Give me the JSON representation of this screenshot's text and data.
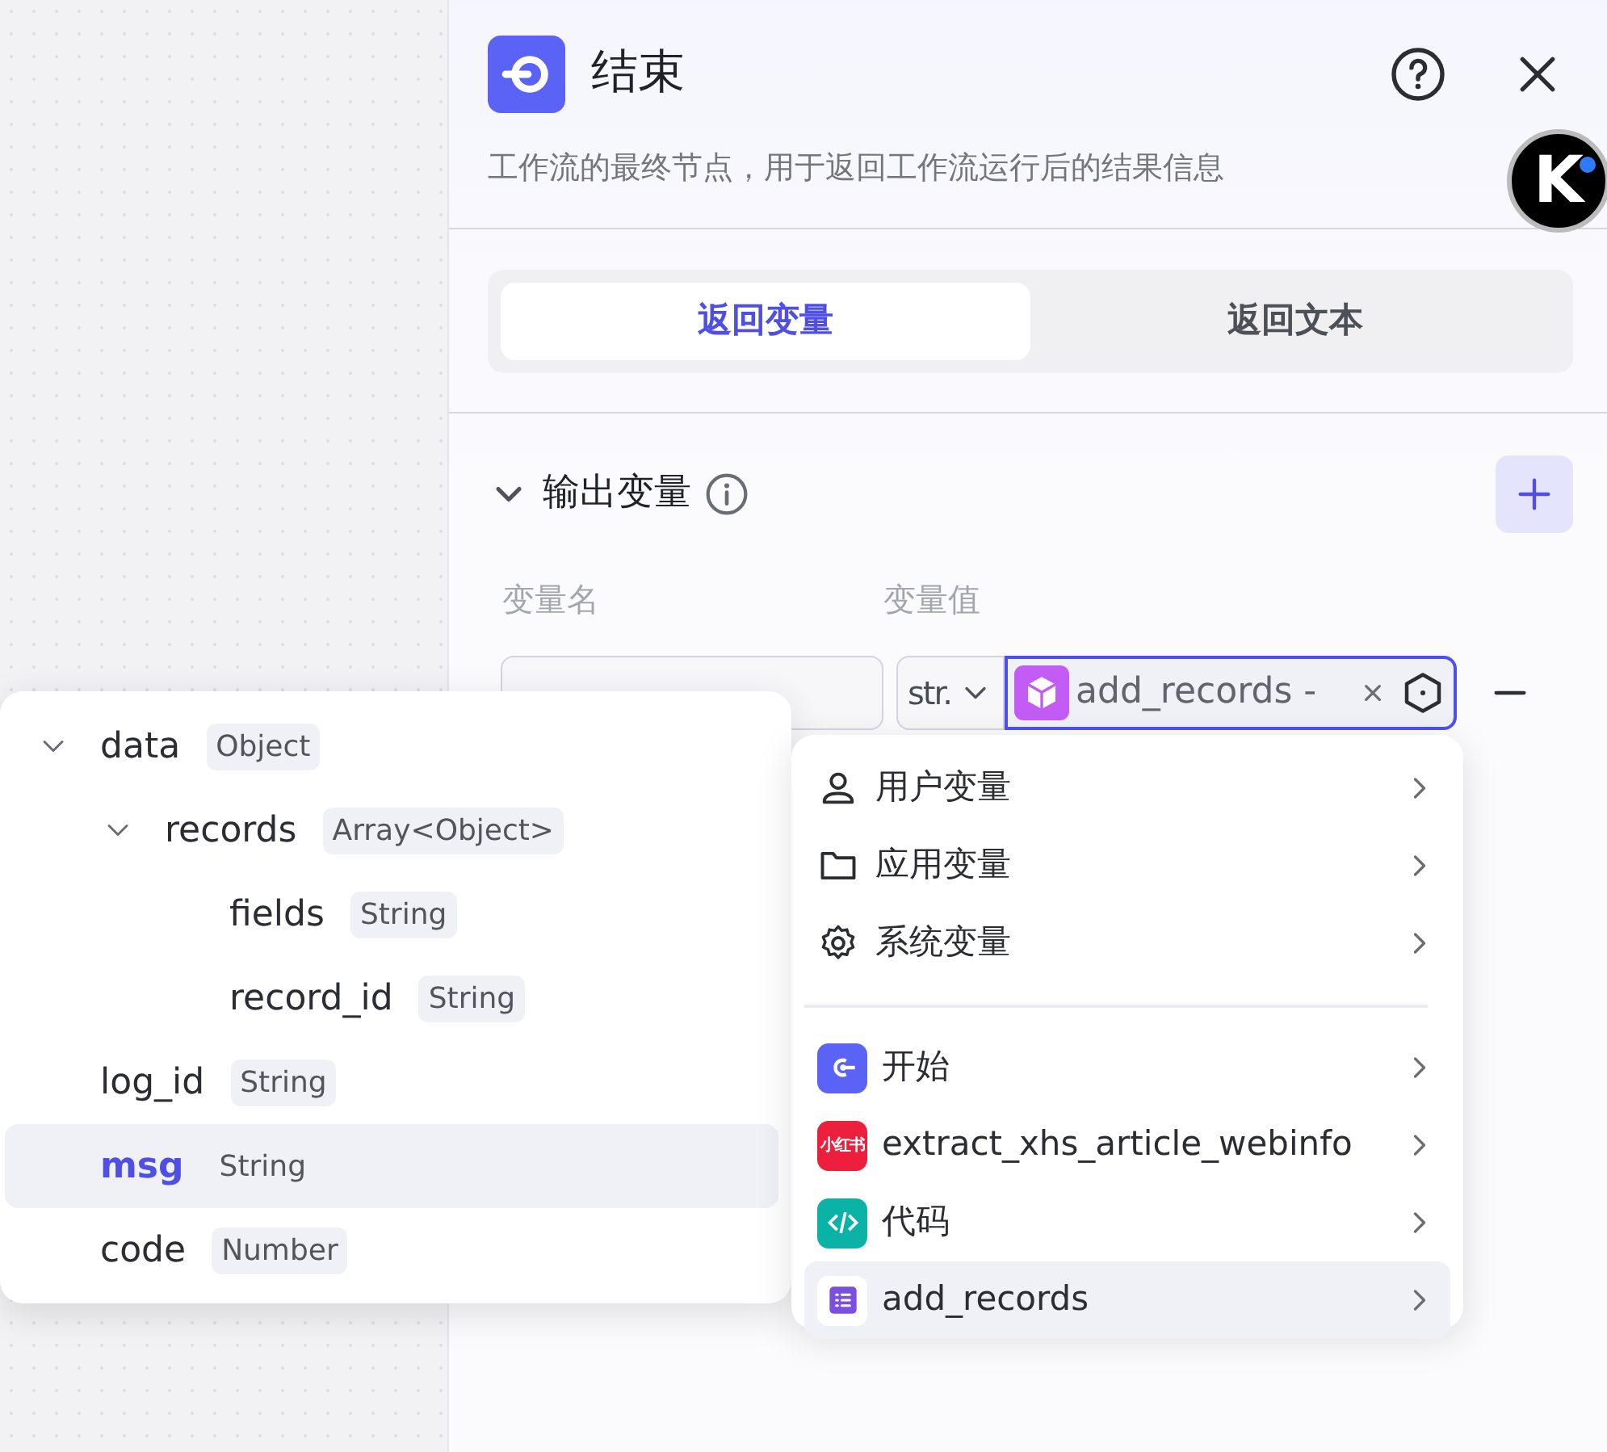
{
  "panel": {
    "title": "结束",
    "description": "工作流的最终节点，用于返回工作流运行后的结果信息"
  },
  "assistant_button": {
    "label": "K"
  },
  "tabs": [
    {
      "label": "返回变量",
      "selected": true
    },
    {
      "label": "返回文本",
      "selected": false
    }
  ],
  "section": {
    "title": "输出变量",
    "expanded": true
  },
  "columns": [
    "变量名",
    "变量值"
  ],
  "output_row": {
    "type": "str.",
    "chip": "add_records -"
  },
  "tree": [
    {
      "name": "data",
      "type": "Object",
      "selected": false,
      "expanded": true,
      "children": [
        {
          "name": "records",
          "type": "Array<Object>",
          "selected": false,
          "expanded": true,
          "children": [
            {
              "name": "fields",
              "type": "String",
              "selected": false
            },
            {
              "name": "record_id",
              "type": "String",
              "selected": false
            }
          ]
        }
      ]
    },
    {
      "name": "log_id",
      "type": "String",
      "selected": false
    },
    {
      "name": "msg",
      "type": "String",
      "selected": true
    },
    {
      "name": "code",
      "type": "Number",
      "selected": false
    }
  ],
  "menu": [
    {
      "items": [
        {
          "kind": "user",
          "label": "用户变量",
          "selected": false
        },
        {
          "kind": "app",
          "label": "应用变量",
          "selected": false
        },
        {
          "kind": "system",
          "label": "系统变量",
          "selected": false
        }
      ]
    },
    {
      "items": [
        {
          "kind": "start",
          "label": "开始",
          "color": "#5b62f6",
          "selected": false
        },
        {
          "kind": "plugin",
          "label": "extract_xhs_article_webinfo",
          "color": "#ec1f3c",
          "icon_text": "小红书",
          "selected": false
        },
        {
          "kind": "code",
          "label": "代码",
          "color": "#0bb3a7",
          "selected": false
        },
        {
          "kind": "table",
          "label": "add_records",
          "color": "#7b4fe0",
          "selected": true
        }
      ]
    }
  ]
}
